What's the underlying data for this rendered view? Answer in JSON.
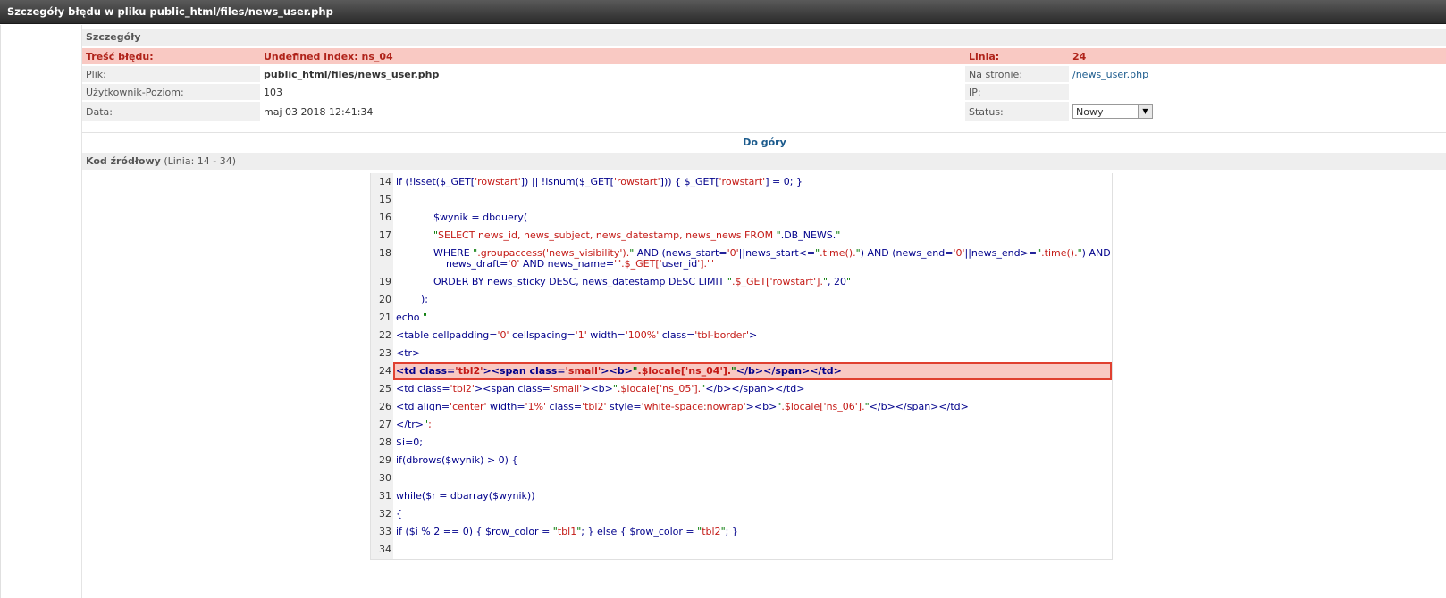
{
  "title": "Szczegóły błędu w pliku public_html/files/news_user.php",
  "details": {
    "header": "Szczegóły",
    "error_label": "Treść błędu:",
    "error_value": "Undefined index: ns_04",
    "line_label": "Linia:",
    "line_value": "24",
    "file_label": "Plik:",
    "file_value": "public_html/files/news_user.php",
    "page_label": "Na stronie:",
    "page_value": "/news_user.php",
    "user_label": "Użytkownik-Poziom:",
    "user_value": "103",
    "ip_label": "IP:",
    "ip_value": "",
    "date_label": "Data:",
    "date_value": "maj 03 2018 12:41:34",
    "status_label": "Status:",
    "status_value": "Nowy"
  },
  "top_link": "Do góry",
  "source": {
    "header_bold": "Kod źródłowy",
    "header_rest": "(Linia: 14 - 34)",
    "highlight_line": 24,
    "lines": [
      {
        "n": "14",
        "code": "if (!isset($_GET['rowstart']) || !isnum($_GET['rowstart'])) { $_GET['rowstart'] = 0; }"
      },
      {
        "n": "15",
        "code": ""
      },
      {
        "n": "16",
        "code": "            $wynik = dbquery("
      },
      {
        "n": "17",
        "code": "            \"SELECT news_id, news_subject, news_datestamp, news_news FROM \".DB_NEWS.\""
      },
      {
        "n": "18",
        "code": "            WHERE \".groupaccess('news_visibility').\" AND (news_start='0'||news_start<=\".time().\") AND (news_end='0'||news_end>=\".time().\") AND\n                news_draft='0' AND news_name='\".$_GET['user_id'].\"'"
      },
      {
        "n": "19",
        "code": "            ORDER BY news_sticky DESC, news_datestamp DESC LIMIT \".$_GET['rowstart'].\", 20\""
      },
      {
        "n": "20",
        "code": "        );"
      },
      {
        "n": "21",
        "code": "echo \""
      },
      {
        "n": "22",
        "code": "<table cellpadding='0' cellspacing='1' width='100%' class='tbl-border'>"
      },
      {
        "n": "23",
        "code": "<tr>"
      },
      {
        "n": "24",
        "code": "<td class='tbl2'><span class='small'><b>\".$locale['ns_04'].\"</b></span></td>"
      },
      {
        "n": "25",
        "code": "<td class='tbl2'><span class='small'><b>\".$locale['ns_05'].\"</b></span></td>"
      },
      {
        "n": "26",
        "code": "<td align='center' width='1%' class='tbl2' style='white-space:nowrap'><b>\".$locale['ns_06'].\"</b></span></td>"
      },
      {
        "n": "27",
        "code": "</tr>\";"
      },
      {
        "n": "28",
        "code": "$i=0;"
      },
      {
        "n": "29",
        "code": "if(dbrows($wynik) > 0) {"
      },
      {
        "n": "30",
        "code": ""
      },
      {
        "n": "31",
        "code": "while($r = dbarray($wynik))"
      },
      {
        "n": "32",
        "code": "{"
      },
      {
        "n": "33",
        "code": "if ($i % 2 == 0) { $row_color = \"tbl1\"; } else { $row_color = \"tbl2\"; }"
      },
      {
        "n": "34",
        "code": ""
      }
    ]
  }
}
